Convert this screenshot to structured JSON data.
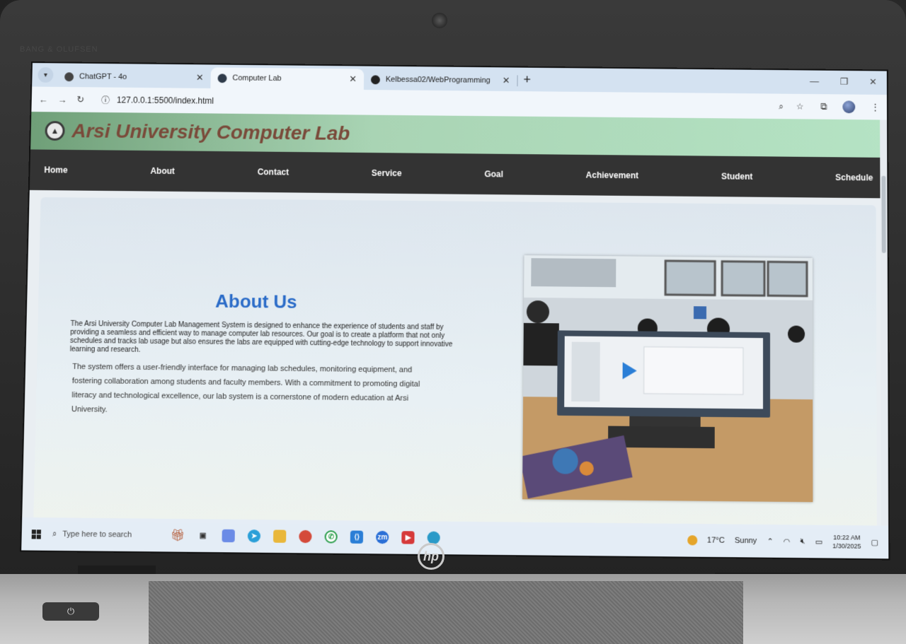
{
  "browser": {
    "tabs": [
      {
        "title": "ChatGPT - 4o",
        "favicon": "chatgpt-icon",
        "active": false
      },
      {
        "title": "Computer Lab",
        "favicon": "globe-icon",
        "active": true
      },
      {
        "title": "Kelbessa02/WebProgramming",
        "favicon": "github-icon",
        "active": false
      }
    ],
    "url": "127.0.0.1:5500/index.html"
  },
  "site": {
    "title": "Arsi University Computer Lab",
    "nav": [
      "Home",
      "About",
      "Contact",
      "Service",
      "Goal",
      "Achievement",
      "Student",
      "Schedule"
    ],
    "about_title": "About Us",
    "about_para1": "The Arsi University Computer Lab Management System is designed to enhance the experience of students and staff by providing a seamless and efficient way to manage computer lab resources. Our goal is to create a platform that not only schedules and tracks lab usage but also ensures the labs are equipped with cutting-edge technology to support innovative learning and research.",
    "about_para2": "The system offers a user-friendly interface for managing lab schedules, monitoring equipment, and fostering collaboration among students and faculty members. With a commitment to promoting digital literacy and technological excellence, our lab system is a cornerstone of modern education at Arsi University."
  },
  "taskbar": {
    "search_placeholder": "Type here to search",
    "weather_temp": "17°C",
    "weather_text": "Sunny",
    "time": "10:22 AM",
    "date": "1/30/2025"
  },
  "laptop": {
    "brand_etch": "BANG & OLUFSEN",
    "logo": "hp"
  },
  "colors": {
    "nav_bg": "#333333",
    "about_title": "#2b6cc8",
    "site_title": "#7a4a3a",
    "header_gradient_end": "#b5e3c4"
  }
}
